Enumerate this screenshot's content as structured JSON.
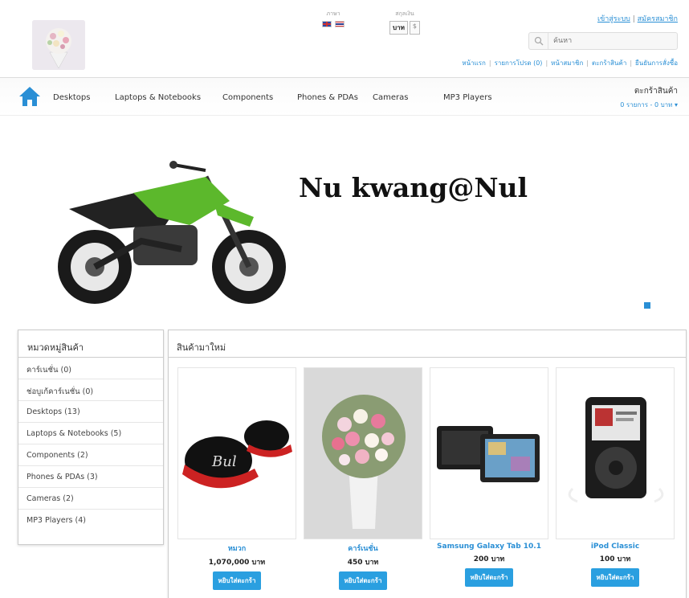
{
  "header": {
    "language_label": "ภาษา",
    "currency_label": "สกุลเงิน",
    "currency_selected": "บาท",
    "currency_other": "$",
    "login_link": "เข้าสู่ระบบ",
    "register_link": "สมัครสมาชิก",
    "account_sep": "|",
    "search_placeholder": "ค้นหา",
    "top_links": [
      "หน้าแรก",
      "รายการโปรด (0)",
      "หน้าสมาชิก",
      "ตะกร้าสินค้า",
      "ยืนยันการสั่งซื้อ"
    ]
  },
  "menu": {
    "items": [
      "Desktops",
      "Laptops & Notebooks",
      "Components",
      "Phones & PDAs",
      "Cameras",
      "MP3 Players"
    ],
    "cart_title": "ตะกร้าสินค้า",
    "cart_total": "0 รายการ - 0 บาท ▾"
  },
  "banner": {
    "title": "Nu kwang@Nul"
  },
  "sidebar": {
    "title": "หมวดหมู่สินค้า",
    "categories": [
      "คาร์เนชั่น (0)",
      "ช่อบูเก้คาร์เนชั่น (0)",
      "Desktops (13)",
      "Laptops & Notebooks (5)",
      "Components (2)",
      "Phones & PDAs (3)",
      "Cameras (2)",
      "MP3 Players (4)"
    ]
  },
  "products": {
    "title": "สินค้ามาใหม่",
    "button_label": "หยิบใส่ตะกร้า",
    "items": [
      {
        "name": "หมวก",
        "price": "1,070,000 บาท"
      },
      {
        "name": "คาร์เนชั่น",
        "price": "450 บาท"
      },
      {
        "name": "Samsung Galaxy Tab 10.1",
        "price": "200 บาท"
      },
      {
        "name": "iPod Classic",
        "price": "100 บาท"
      }
    ]
  },
  "colors": {
    "accent": "#2a8fd5",
    "button": "#2a9fe0"
  }
}
